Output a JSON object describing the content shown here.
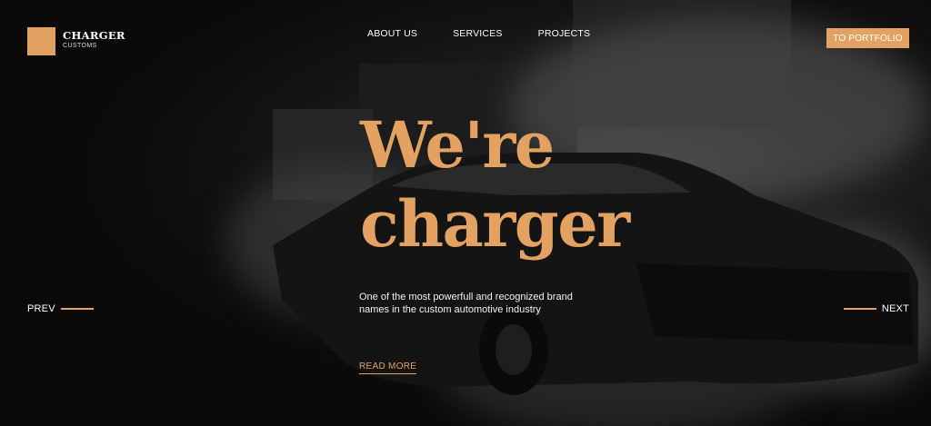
{
  "brand": {
    "name": "CHARGER",
    "tagline": "CUSTOMS"
  },
  "nav": {
    "items": [
      "ABOUT US",
      "SERVICES",
      "PROJECTS"
    ]
  },
  "portfolio_button": "TO PORTFOLIO",
  "hero": {
    "title_line1": "We're",
    "title_line2": "charger",
    "description": "One of the most powerfull and recognized brand names in the custom automotive industry",
    "read_more": "READ MORE"
  },
  "slider": {
    "prev": "PREV",
    "next": "NEXT"
  },
  "colors": {
    "accent": "#e4a262",
    "background": "#0b0b0b"
  }
}
